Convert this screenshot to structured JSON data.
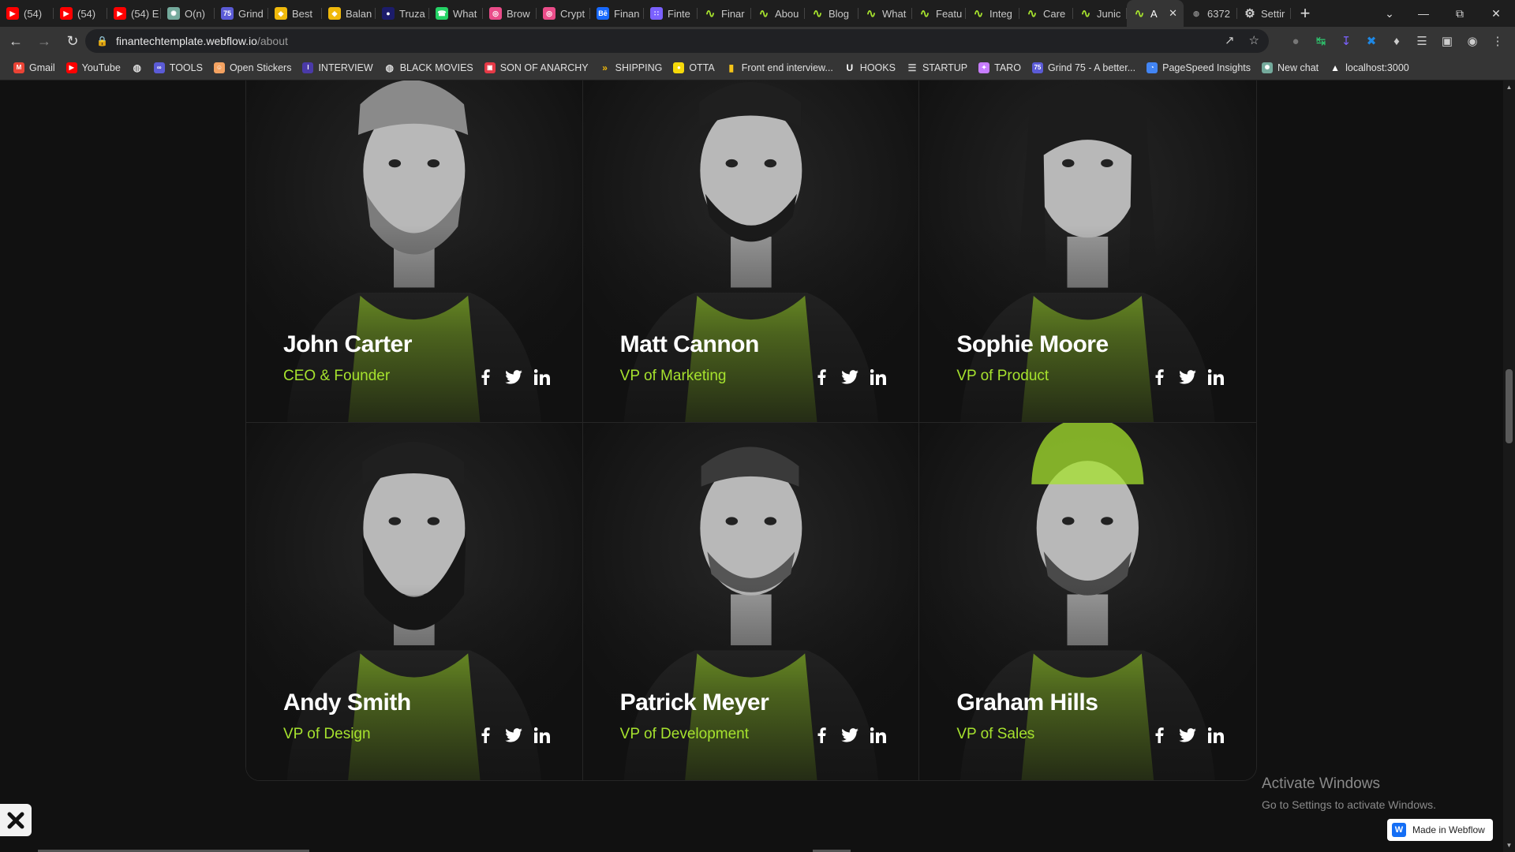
{
  "browser": {
    "tabs": [
      {
        "label": "(54)",
        "icon": "youtube-icon",
        "color": "#ff0000"
      },
      {
        "label": "(54)",
        "icon": "youtube-icon",
        "color": "#ff0000"
      },
      {
        "label": "(54) E",
        "icon": "youtube-icon",
        "color": "#ff0000"
      },
      {
        "label": "O(n)",
        "icon": "chatgpt-icon",
        "color": "#74aa9c"
      },
      {
        "label": "Grind",
        "icon": "grind75-icon",
        "color": "#5b5bd6"
      },
      {
        "label": "Best",
        "icon": "binance-icon",
        "color": "#f0b90b"
      },
      {
        "label": "Balan",
        "icon": "binance-icon",
        "color": "#f0b90b"
      },
      {
        "label": "Truza",
        "icon": "truza-icon",
        "color": "#1c1c6b"
      },
      {
        "label": "What",
        "icon": "whatsapp-icon",
        "color": "#25d366"
      },
      {
        "label": "Brow",
        "icon": "dribbble-icon",
        "color": "#ea4c89"
      },
      {
        "label": "Crypt",
        "icon": "dribbble-icon",
        "color": "#ea4c89"
      },
      {
        "label": "Finan",
        "icon": "behance-icon",
        "color": "#1769ff"
      },
      {
        "label": "Finte",
        "icon": "dots-icon",
        "color": "#7b61ff"
      },
      {
        "label": "Finar",
        "icon": "webflow-template-icon",
        "color": "#a6e22e"
      },
      {
        "label": "Abou",
        "icon": "webflow-template-icon",
        "color": "#a6e22e"
      },
      {
        "label": "Blog",
        "icon": "webflow-template-icon",
        "color": "#a6e22e"
      },
      {
        "label": "What",
        "icon": "webflow-template-icon",
        "color": "#a6e22e"
      },
      {
        "label": "Featu",
        "icon": "webflow-template-icon",
        "color": "#a6e22e"
      },
      {
        "label": "Integ",
        "icon": "webflow-template-icon",
        "color": "#a6e22e"
      },
      {
        "label": "Care",
        "icon": "webflow-template-icon",
        "color": "#a6e22e"
      },
      {
        "label": "Junic",
        "icon": "webflow-template-icon",
        "color": "#a6e22e"
      },
      {
        "label": "A",
        "icon": "webflow-template-icon",
        "color": "#a6e22e",
        "active": true
      },
      {
        "label": "6372",
        "icon": "globe-icon",
        "color": "#888888"
      },
      {
        "label": "Settir",
        "icon": "gear-icon",
        "color": "#cccccc"
      }
    ],
    "url_host": "finantechtemplate.webflow.io",
    "url_path": "/about",
    "bookmarks": [
      {
        "label": "Gmail",
        "icon": "gmail-icon",
        "color": "#ea4335"
      },
      {
        "label": "YouTube",
        "icon": "youtube-icon",
        "color": "#ff0000"
      },
      {
        "label": "",
        "icon": "globe-icon",
        "color": "#dddddd"
      },
      {
        "label": "TOOLS",
        "icon": "tools-icon",
        "color": "#5b5bd6"
      },
      {
        "label": "Open Stickers",
        "icon": "stickers-icon",
        "color": "#f4a261"
      },
      {
        "label": "INTERVIEW",
        "icon": "interview-icon",
        "color": "#4a3aa8"
      },
      {
        "label": "BLACK MOVIES",
        "icon": "globe-icon",
        "color": "#dddddd"
      },
      {
        "label": "SON OF ANARCHY",
        "icon": "tv-icon",
        "color": "#e63946"
      },
      {
        "label": "SHIPPING",
        "icon": "chevrons-icon",
        "color": "#f0b90b"
      },
      {
        "label": "OTTA",
        "icon": "otta-icon",
        "color": "#f5d90a"
      },
      {
        "label": "Front end interview...",
        "icon": "bookmark-icon",
        "color": "#f5c518"
      },
      {
        "label": "HOOKS",
        "icon": "hooks-icon",
        "color": "#ffffff"
      },
      {
        "label": "STARTUP",
        "icon": "list-icon",
        "color": "#cccccc"
      },
      {
        "label": "TARO",
        "icon": "taro-icon",
        "color": "#c77dff"
      },
      {
        "label": "Grind 75 - A better...",
        "icon": "grind75-icon",
        "color": "#5b5bd6"
      },
      {
        "label": "PageSpeed Insights",
        "icon": "pagespeed-icon",
        "color": "#4285f4"
      },
      {
        "label": "New chat",
        "icon": "chatgpt-icon",
        "color": "#74aa9c"
      },
      {
        "label": "localhost:3000",
        "icon": "triangle-icon",
        "color": "#ffffff"
      }
    ]
  },
  "team": {
    "accent": "#a6e22e",
    "members": [
      {
        "name": "John Carter",
        "role": "CEO & Founder",
        "look": "gray-beard"
      },
      {
        "name": "Matt Cannon",
        "role": "VP of Marketing",
        "look": "short-beard"
      },
      {
        "name": "Sophie Moore",
        "role": "VP of Product",
        "look": "long-hair"
      },
      {
        "name": "Andy Smith",
        "role": "VP of Design",
        "look": "full-beard"
      },
      {
        "name": "Patrick Meyer",
        "role": "VP of Development",
        "look": "stubble"
      },
      {
        "name": "Graham Hills",
        "role": "VP of Sales",
        "look": "beanie"
      }
    ],
    "social_icons": [
      "facebook-icon",
      "twitter-icon",
      "linkedin-icon"
    ]
  },
  "overlays": {
    "activate_title": "Activate Windows",
    "activate_sub": "Go to Settings to activate Windows.",
    "webflow_badge": "Made in Webflow",
    "webflow_logo": "W"
  }
}
